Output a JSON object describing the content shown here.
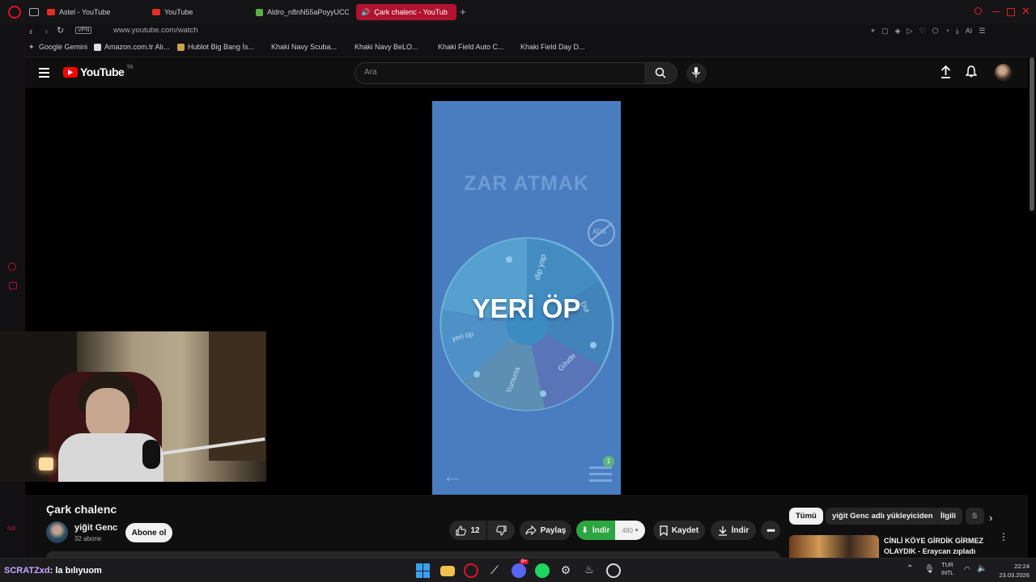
{
  "browser": {
    "tabs": [
      {
        "label": "Astel - YouTube"
      },
      {
        "label": "YouTube"
      },
      {
        "label": "Aldro_n8nN55aPoyyUCOT"
      },
      {
        "label": "Çark chalenc - YouTub"
      }
    ],
    "vpn_label": "VPN",
    "url": "www.youtube.com/watch",
    "ai_label": "AI",
    "bookmarks": [
      {
        "label": "Google Gemini"
      },
      {
        "label": "Amazon.com.tr Alı..."
      },
      {
        "label": "Hublot Big Bang İs..."
      },
      {
        "label": "Khaki Navy Scuba..."
      },
      {
        "label": "Khaki Navy BeLO..."
      },
      {
        "label": "Khaki Field Auto C..."
      },
      {
        "label": "Khaki Field Day D..."
      }
    ]
  },
  "youtube": {
    "logo_text": "YouTube",
    "logo_region": "TR",
    "search_placeholder": "Ara"
  },
  "video_frame": {
    "title_text": "ZAR ATMAK",
    "result_text": "YERİ ÖP",
    "wheel_segments": [
      "dip yap",
      "yeri öp",
      "Yumurta",
      "Gövde",
      "Dur"
    ],
    "badge_text": "ADS",
    "badge_count": "1"
  },
  "video": {
    "title": "Çark chalenc",
    "channel": "yiğit Genc",
    "subscribers": "32 abone",
    "subscribe_label": "Abone ol",
    "likes": "12",
    "share_label": "Paylaş",
    "indir_green_label": "İndir",
    "indir_green_count": "480",
    "save_label": "Kaydet",
    "download_label": "İndir"
  },
  "recommendations": {
    "chips": [
      "Tümü",
      "yiğit Genc adlı yükleyiciden",
      "İlgili",
      "S"
    ],
    "first_title_line1": "CİNLİ KÖYE GİRDİK GİRMEZ",
    "first_title_line2": "OLAYDIK - Eraycan zıpladı"
  },
  "stream": {
    "chat_user": "SCRATZxd",
    "chat_message": ": la bılıyuom"
  },
  "taskbar": {
    "lang_line1": "TUR",
    "lang_line2": "INTL",
    "time": "22:24",
    "date": "23.03.2026",
    "discord_badge": "9+"
  },
  "colors": {
    "browser_accent": "#b0132f",
    "youtube_red": "#ff0000",
    "video_background": "#4a7dc0",
    "green_download": "#2ba640"
  }
}
